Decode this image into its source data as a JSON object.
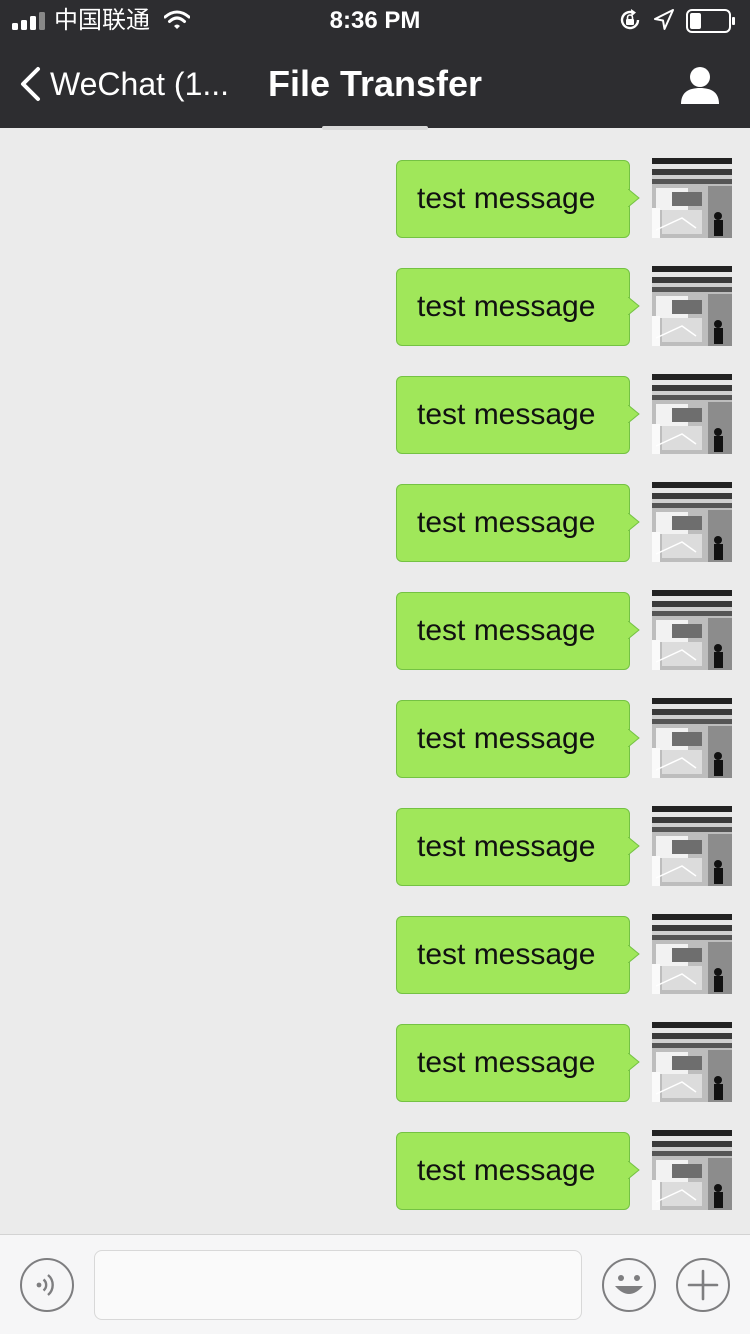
{
  "status_bar": {
    "carrier": "中国联通",
    "time": "8:36 PM"
  },
  "nav": {
    "back_label": "WeChat (1...",
    "title": "File Transfer"
  },
  "messages": [
    {
      "text": "test message"
    },
    {
      "text": "test message"
    },
    {
      "text": "test message"
    },
    {
      "text": "test message"
    },
    {
      "text": "test message"
    },
    {
      "text": "test message"
    },
    {
      "text": "test message"
    },
    {
      "text": "test message"
    },
    {
      "text": "test message"
    },
    {
      "text": "test message"
    }
  ],
  "input_bar": {
    "message_value": "",
    "icons": [
      "voice-icon",
      "emoji-icon",
      "plus-icon"
    ]
  },
  "colors": {
    "nav_background": "#2d2d30",
    "chat_background": "#ebebeb",
    "bubble_green": "#a0e75a"
  }
}
